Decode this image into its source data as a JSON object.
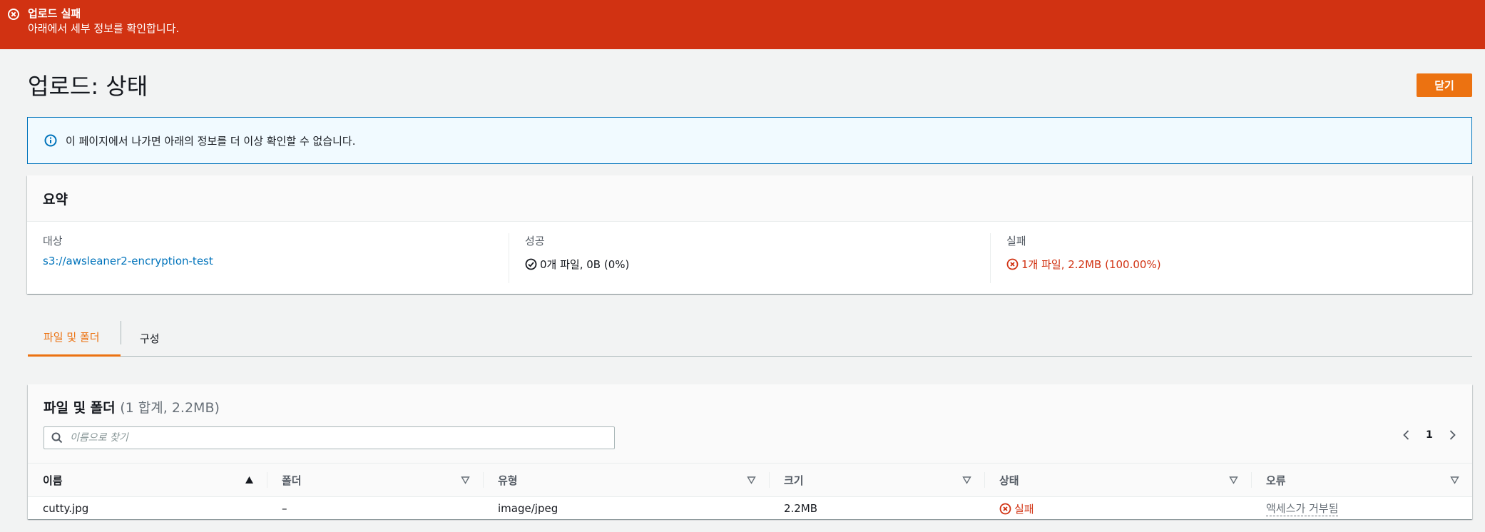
{
  "flash": {
    "title": "업로드 실패",
    "message": "아래에서 세부 정보를 확인합니다.",
    "icon": "error-circle-icon",
    "color": "#d13212"
  },
  "header": {
    "title": "업로드: 상태",
    "close_label": "닫기"
  },
  "info_alert": {
    "icon": "info-circle-icon",
    "text": "이 페이지에서 나가면 아래의 정보를 더 이상 확인할 수 없습니다."
  },
  "summary": {
    "title": "요약",
    "target_label": "대상",
    "target_value": "s3://awsleaner2-encryption-test",
    "success_label": "성공",
    "success_value": "0개 파일, 0B (0%)",
    "failure_label": "실패",
    "failure_value": "1개 파일, 2.2MB (100.00%)"
  },
  "tabs": [
    {
      "label": "파일 및 폴더",
      "active": true
    },
    {
      "label": "구성",
      "active": false
    }
  ],
  "files": {
    "title": "파일 및 폴더",
    "count": "(1 합계, 2.2MB)",
    "search_placeholder": "이름으로 찾기",
    "page": "1",
    "columns": [
      "이름",
      "폴더",
      "유형",
      "크기",
      "상태",
      "오류"
    ],
    "rows": [
      {
        "name": "cutty.jpg",
        "folder": "–",
        "type": "image/jpeg",
        "size": "2.2MB",
        "status": "실패",
        "error": "액세스가 거부됨"
      }
    ]
  },
  "colors": {
    "accent": "#ec7211",
    "error": "#d13212",
    "link": "#0073bb"
  }
}
